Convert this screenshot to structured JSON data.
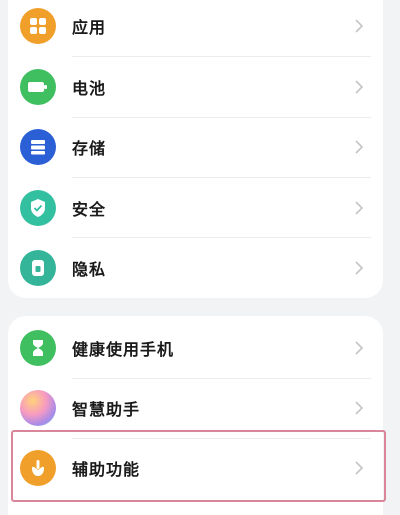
{
  "settings": {
    "group1": [
      {
        "label": "应用",
        "icon": "apps-grid-icon",
        "color": "#f0a02a"
      },
      {
        "label": "电池",
        "icon": "battery-icon",
        "color": "#3fbf5f"
      },
      {
        "label": "存储",
        "icon": "storage-icon",
        "color": "#2a5fd6"
      },
      {
        "label": "安全",
        "icon": "shield-icon",
        "color": "#33c0a0"
      },
      {
        "label": "隐私",
        "icon": "privacy-lock-icon",
        "color": "#34b59a"
      }
    ],
    "group2": [
      {
        "label": "健康使用手机",
        "icon": "hourglass-icon",
        "color": "#3fbf5f"
      },
      {
        "label": "智慧助手",
        "icon": "assistant-orb-icon",
        "color": "#c890e8"
      },
      {
        "label": "辅助功能",
        "icon": "accessibility-hand-icon",
        "color": "#f0a02a"
      }
    ]
  },
  "highlight_color": "#d9859a"
}
